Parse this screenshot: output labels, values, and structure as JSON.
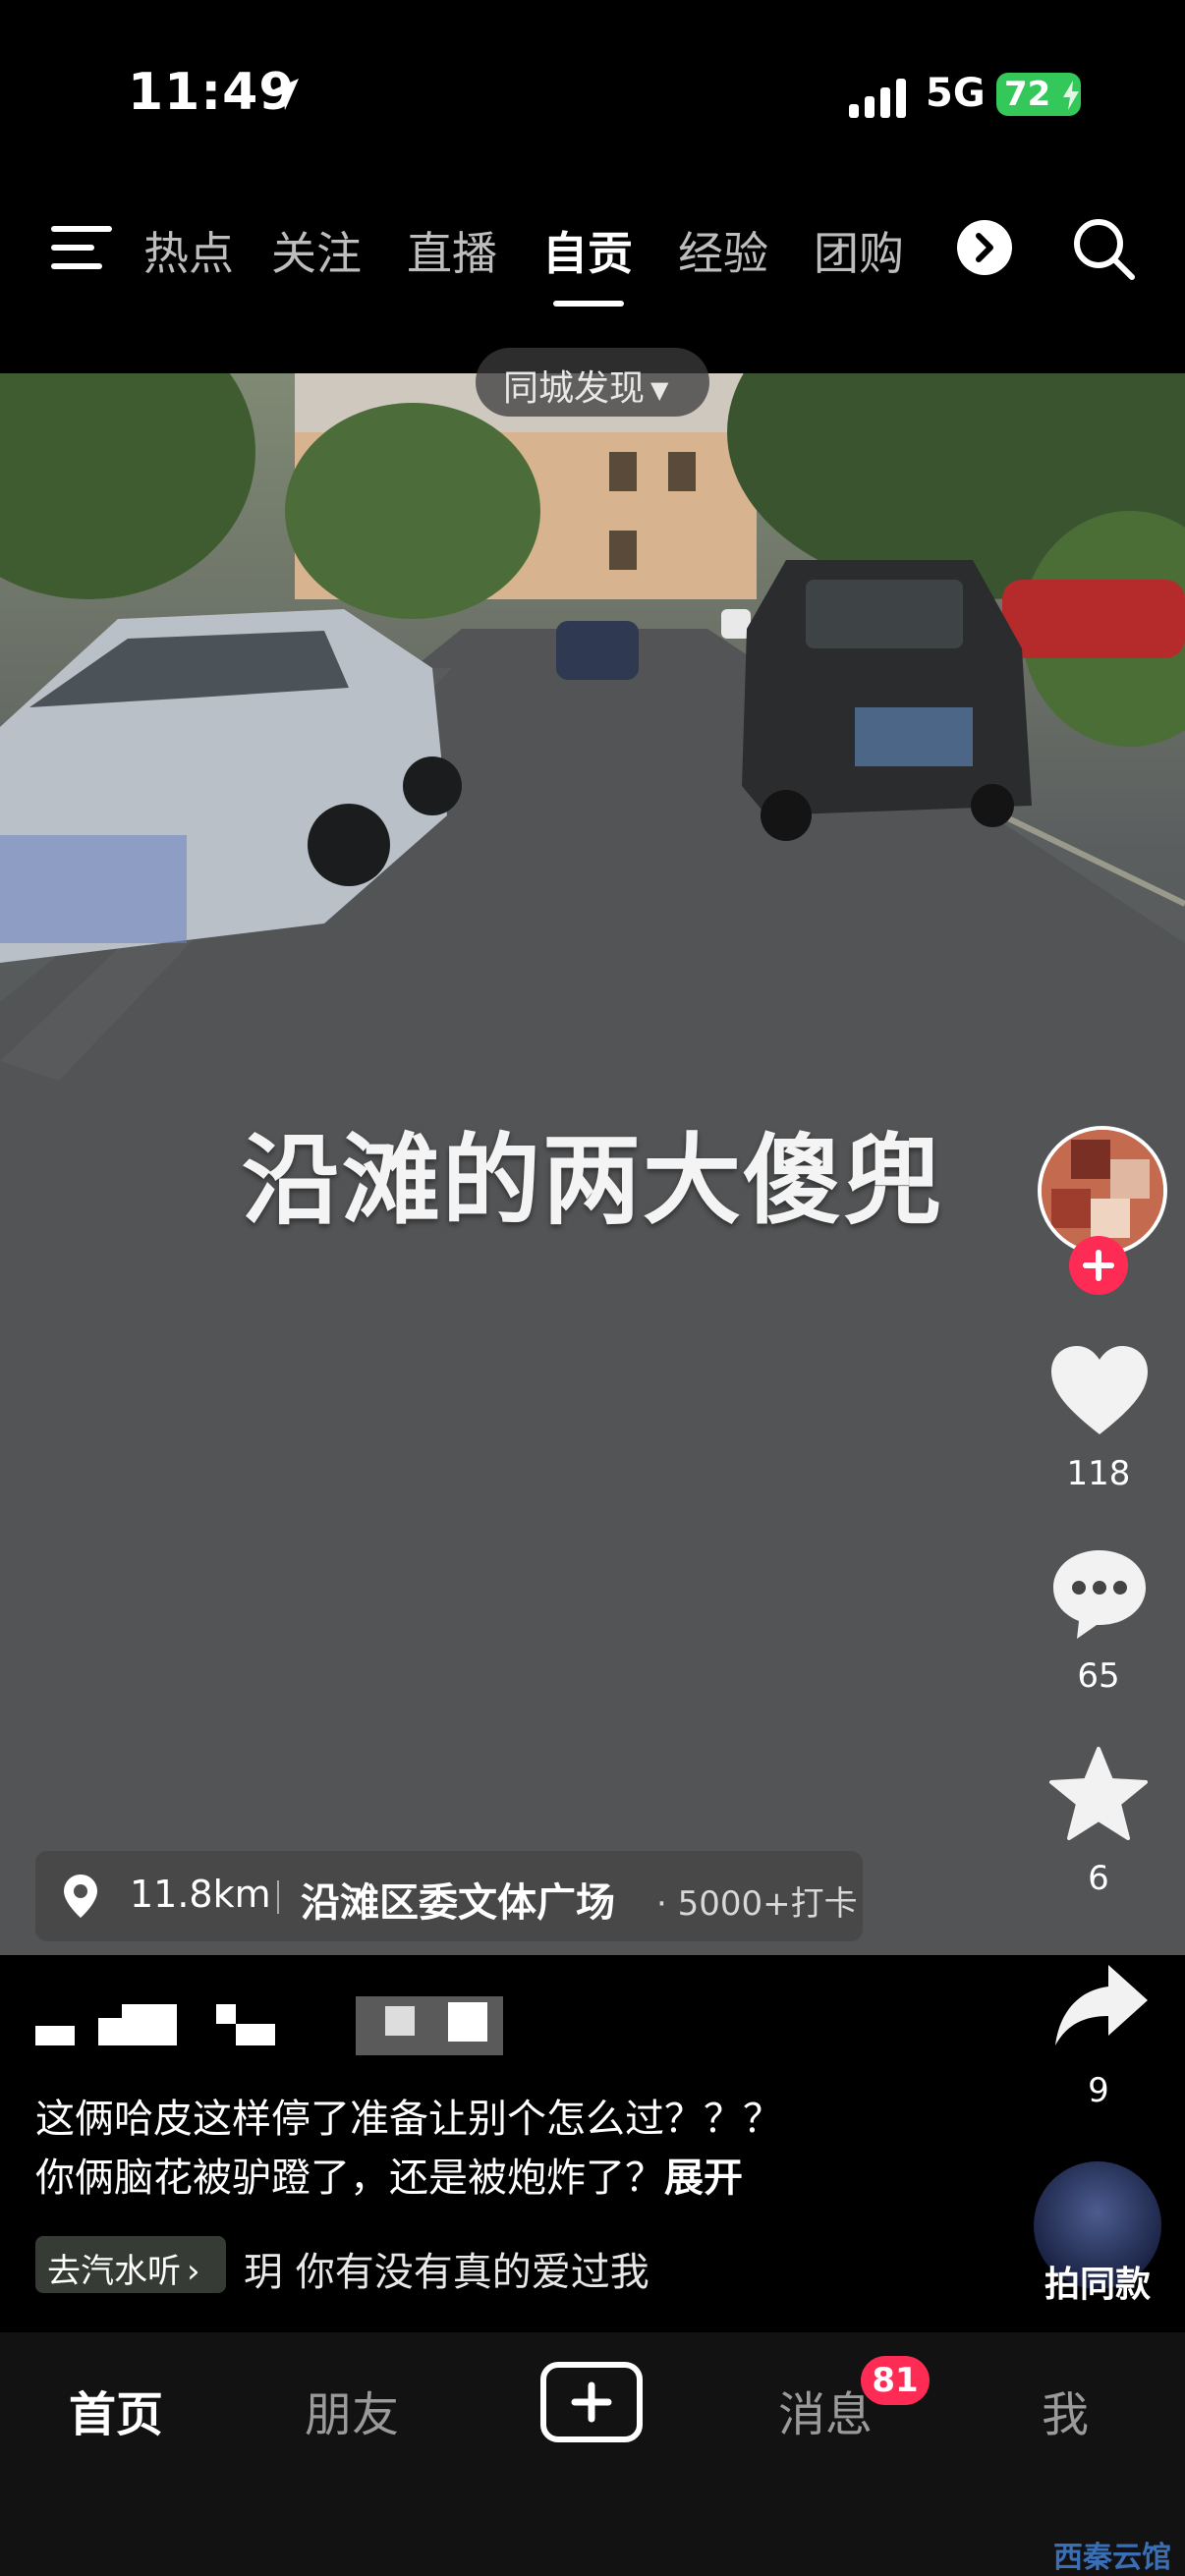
{
  "status_bar": {
    "time": "11:49",
    "network": "5G",
    "battery": "72",
    "icons": [
      "location-arrow-icon",
      "signal-icon",
      "battery-charging-icon"
    ]
  },
  "top_nav": {
    "tabs": [
      {
        "label": "热点"
      },
      {
        "label": "关注"
      },
      {
        "label": "直播"
      },
      {
        "label": "自贡"
      },
      {
        "label": "经验"
      },
      {
        "label": "团购"
      }
    ],
    "active_tab": "自贡",
    "icons": [
      "menu-icon",
      "chevron-right-icon",
      "search-icon"
    ]
  },
  "video": {
    "discover_dropdown": "同城发现",
    "caption": "沿滩的两大傻兜"
  },
  "location": {
    "distance": "11.8km",
    "name": "沿滩区委文体广场",
    "checkins": "· 5000+打卡"
  },
  "right_rail": {
    "likes": "118",
    "comments": "65",
    "favorites": "6",
    "shares": "9",
    "same_style_label": "拍同款",
    "icons": [
      "heart-icon",
      "comment-icon",
      "star-icon",
      "share-icon",
      "plus-icon"
    ]
  },
  "post": {
    "description_line1": "这俩哈皮这样停了准备让别个怎么过？？？",
    "description_line2": "你俩脑花被驴蹬了，还是被炮炸了？",
    "expand_label": "展开",
    "music_chip": "去汽水听",
    "music_title": "玥    你有没有真的爱过我"
  },
  "bottom_nav": {
    "home": "首页",
    "friends": "朋友",
    "messages": "消息",
    "messages_badge": "81",
    "me": "我"
  },
  "watermark": "西秦云馆",
  "colors": {
    "accent": "#fe2c55",
    "battery": "#34c759",
    "background": "#000000"
  }
}
